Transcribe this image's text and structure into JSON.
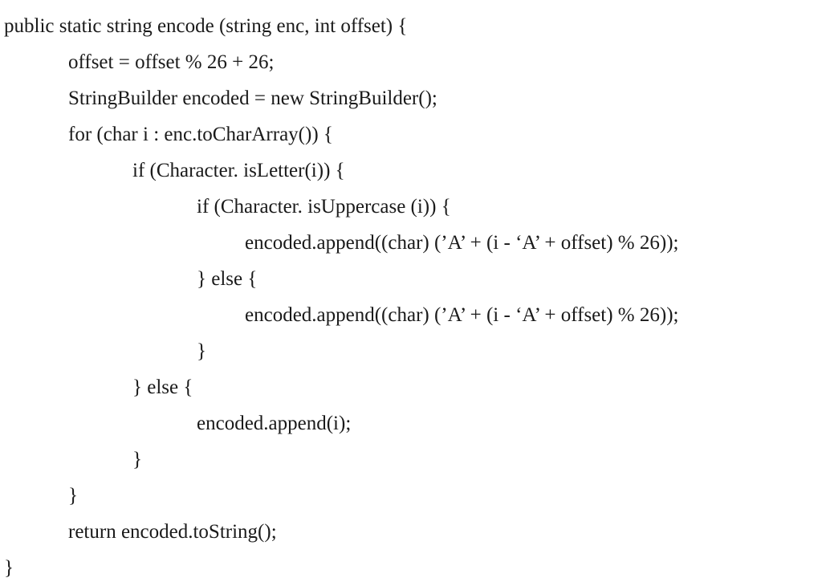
{
  "code": {
    "line1": "public static string encode (string enc, int offset) {",
    "line2": "offset = offset % 26 + 26;",
    "line3": "StringBuilder encoded =  new StringBuilder();",
    "line4": "for (char i : enc.toCharArray()) {",
    "line5": "if (Character. isLetter(i)) {",
    "line6": "if (Character. isUppercase (i)) {",
    "line7": "encoded.append((char) (’A’ + (i - ‘A’ + offset) % 26));",
    "line8": "} else {",
    "line9": "encoded.append((char) (’A’ + (i - ‘A’ + offset) % 26));",
    "line10": "}",
    "line11": "} else {",
    "line12": "encoded.append(i);",
    "line13": "}",
    "line14": "}",
    "line15": "return encoded.toString();",
    "line16": "}"
  }
}
